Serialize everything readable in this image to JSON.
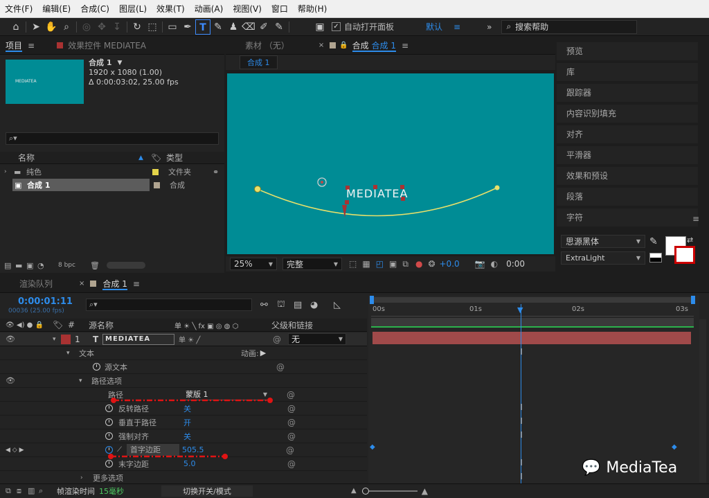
{
  "menu": [
    "文件(F)",
    "编辑(E)",
    "合成(C)",
    "图层(L)",
    "效果(T)",
    "动画(A)",
    "视图(V)",
    "窗口",
    "帮助(H)"
  ],
  "toolbar": {
    "auto_open_panel": "自动打开面板",
    "workspace": "默认",
    "search_placeholder": "搜索帮助"
  },
  "project_panel": {
    "tab_project": "项目",
    "tab_effects": "效果控件 MEDIATEA",
    "thumb_text": "MEDIATEA",
    "comp_name": "合成 1",
    "comp_res": "1920 x 1080 (1.00)",
    "comp_dur": "Δ 0:00:03:02, 25.00 fps",
    "col_name": "名称",
    "col_type": "类型",
    "items": [
      {
        "name": "纯色",
        "type": "文件夹",
        "color": "#e4d44a"
      },
      {
        "name": "合成 1",
        "type": "合成",
        "color": "#b0a490"
      }
    ],
    "bpc": "8 bpc"
  },
  "viewer": {
    "tab_footage": "素材 （无）",
    "tab_comp_prefix": "合成",
    "tab_comp_name": "合成 1",
    "sub_tab": "合成 1",
    "text": "MEDIATEA",
    "bg_color": "#008c95",
    "zoom": "25%",
    "quality": "完整",
    "exposure": "+0.0",
    "timecode": "0:00"
  },
  "right_panel": {
    "items": [
      "预览",
      "库",
      "跟踪器",
      "内容识别填充",
      "对齐",
      "平滑器",
      "效果和预设",
      "段落",
      "字符"
    ],
    "font_family": "思源黑体",
    "font_style": "ExtraLight"
  },
  "timeline": {
    "tab_render": "渲染队列",
    "tab_comp": "合成 1",
    "timecode": "0:00:01:11",
    "frame_info": "00036 (25.00 fps)",
    "col_source_name": "源名称",
    "col_parent": "父级和链接",
    "ruler": [
      "00s",
      "01s",
      "02s",
      "03s"
    ],
    "layer": {
      "num": "1",
      "name": "MEDIATEA",
      "parent": "无",
      "color": "#a93232"
    },
    "props": {
      "text": "文本",
      "animate": "动画:",
      "source_text": "源文本",
      "path_options": "路径选项",
      "path": "路径",
      "path_value": "蒙版 1",
      "reverse_path": "反转路径",
      "reverse_value": "关",
      "perpendicular": "垂直于路径",
      "perpendicular_value": "开",
      "force_align": "强制对齐",
      "force_value": "关",
      "first_margin": "首字边距",
      "first_value": "505.5",
      "last_margin": "末字边距",
      "last_value": "5.0",
      "more_options": "更多选项"
    },
    "footer": {
      "render_time_label": "帧渲染时间",
      "render_time_value": "15毫秒",
      "toggle_modes": "切换开关/模式"
    }
  },
  "watermark": "MediaTea"
}
